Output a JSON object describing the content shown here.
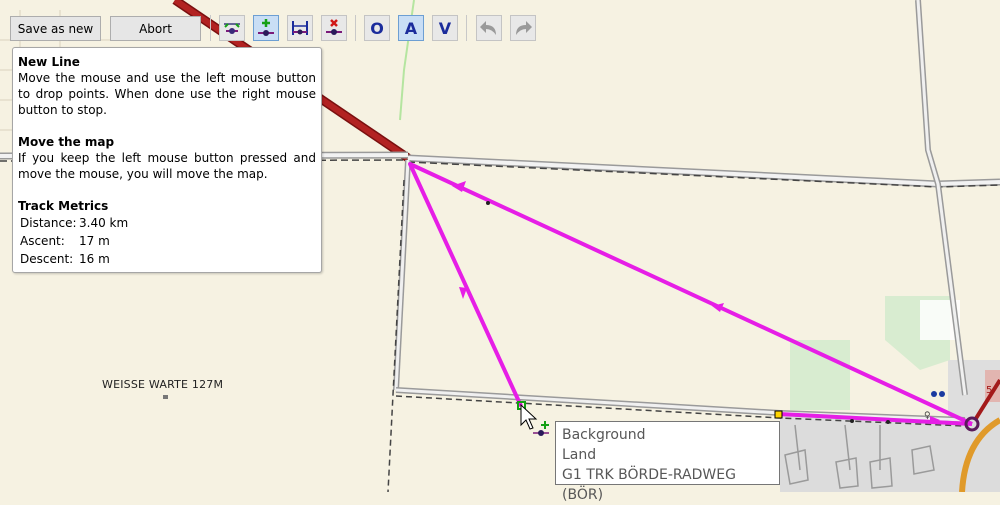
{
  "toolbar": {
    "save_as_new_label": "Save as new",
    "abort_label": "Abort",
    "icons": [
      {
        "name": "move-points-icon",
        "active": false
      },
      {
        "name": "add-point-icon",
        "active": true
      },
      {
        "name": "select-range-icon",
        "active": false
      },
      {
        "name": "delete-point-icon",
        "active": false
      }
    ],
    "routing_letters": [
      "O",
      "A",
      "V"
    ],
    "undo_icon": "undo-icon",
    "redo_icon": "redo-icon",
    "accent_color": "#1b2c9c"
  },
  "help": {
    "new_line_title": "New Line",
    "new_line_text": "Move the mouse and use the left mouse button to drop points. When done use the right mouse button to stop.",
    "move_map_title": "Move the map",
    "move_map_text": "If you keep the left mouse button pressed and move the mouse, you will move the map.",
    "metrics_title": "Track Metrics",
    "metrics": [
      {
        "label": "Distance:",
        "value": "3.40 km"
      },
      {
        "label": "Ascent:",
        "value": "17 m"
      },
      {
        "label": "Descent:",
        "value": "16 m"
      }
    ]
  },
  "map": {
    "place_label": "WEISSE WARTE 127M",
    "track_color": "#e61ee6",
    "road_color": "#a31a1a",
    "background_color": "#f6f2e2"
  },
  "tooltip": {
    "lines": [
      "Background",
      "Land",
      "G1 TRK BÖRDE-RADWEG (BÖR)"
    ]
  }
}
